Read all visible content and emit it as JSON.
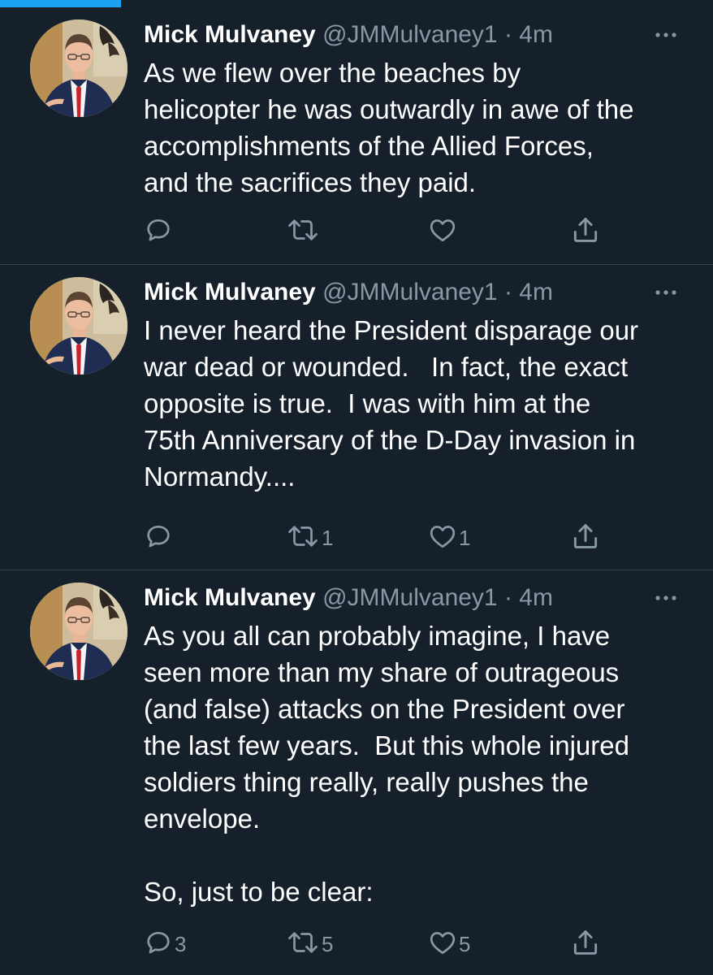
{
  "progress": {
    "fraction": 0.17,
    "color": "#1da1f2"
  },
  "tweets": [
    {
      "name": "Mick Mulvaney",
      "handle_time": "@JMMulvaney1 · 4m",
      "text": "As we flew over the beaches by\nhelicopter he was outwardly in awe of the\naccomplishments of the Allied Forces,\nand the sacrifices they paid.",
      "reply_count": "",
      "retweet_count": "",
      "like_count": ""
    },
    {
      "name": "Mick Mulvaney",
      "handle_time": "@JMMulvaney1 · 4m",
      "text": "I never heard the President disparage our\nwar dead or wounded.   In fact, the exact\nopposite is true.  I was with him at the\n75th Anniversary of the D-Day invasion in\nNormandy....",
      "reply_count": "",
      "retweet_count": "1",
      "like_count": "1"
    },
    {
      "name": "Mick Mulvaney",
      "handle_time": "@JMMulvaney1 · 4m",
      "text": "As you all can probably imagine, I have\nseen more than my share of outrageous\n(and false) attacks on the President over\nthe last few years.  But this whole injured\nsoldiers thing really, really pushes the\nenvelope.\n\nSo, just to be clear:",
      "reply_count": "3",
      "retweet_count": "5",
      "like_count": "5"
    }
  ],
  "icons": {
    "reply": "reply-icon",
    "retweet": "retweet-icon",
    "like": "heart-icon",
    "share": "share-icon",
    "more": "more-icon"
  },
  "colors": {
    "background": "#15202b",
    "secondary_text": "#8899a6",
    "divider": "#38444d",
    "accent": "#1da1f2"
  }
}
